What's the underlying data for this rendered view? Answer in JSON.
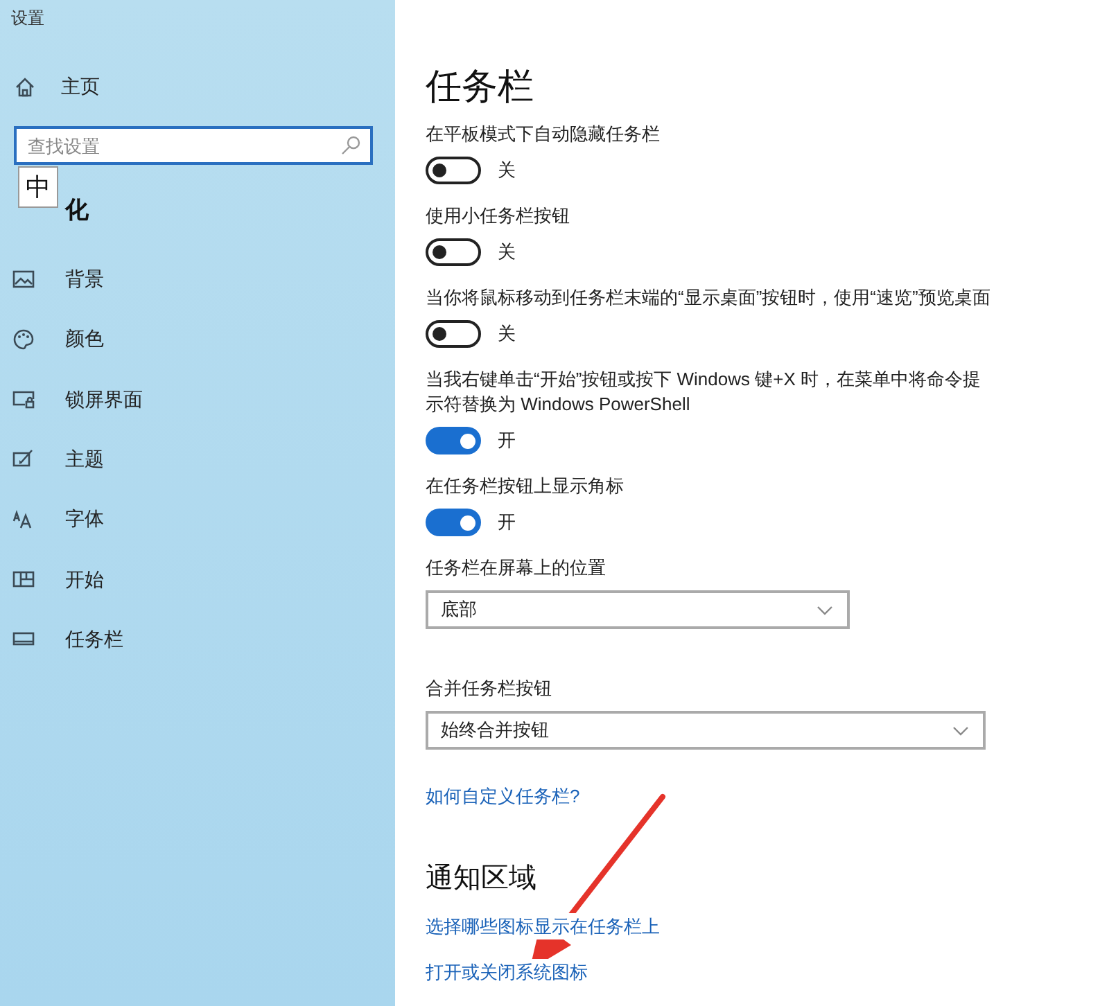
{
  "window": {
    "title": "设置"
  },
  "sidebar": {
    "home": "主页",
    "search": {
      "placeholder": "查找设置"
    },
    "ime_indicator": "中",
    "section": "化",
    "items": [
      {
        "label": "背景"
      },
      {
        "label": "颜色"
      },
      {
        "label": "锁屏界面"
      },
      {
        "label": "主题"
      },
      {
        "label": "字体"
      },
      {
        "label": "开始"
      },
      {
        "label": "任务栏"
      }
    ]
  },
  "main": {
    "title": "任务栏",
    "settings": [
      {
        "kind": "toggle",
        "label": "在平板模式下自动隐藏任务栏",
        "on": false,
        "state_text": "关"
      },
      {
        "kind": "toggle",
        "label": "使用小任务栏按钮",
        "on": false,
        "state_text": "关"
      },
      {
        "kind": "toggle",
        "label": "当你将鼠标移动到任务栏末端的“显示桌面”按钮时，使用“速览”预览桌面",
        "on": false,
        "state_text": "关"
      },
      {
        "kind": "toggle",
        "label": "当我右键单击“开始”按钮或按下 Windows 键+X 时，在菜单中将命令提示符替换为 Windows PowerShell",
        "on": true,
        "state_text": "开"
      },
      {
        "kind": "toggle",
        "label": "在任务栏按钮上显示角标",
        "on": true,
        "state_text": "开"
      },
      {
        "kind": "dropdown",
        "label": "任务栏在屏幕上的位置",
        "value": "底部"
      },
      {
        "kind": "dropdown",
        "label": "合并任务栏按钮",
        "value": "始终合并按钮"
      }
    ],
    "help_link": "如何自定义任务栏?",
    "notification_area": {
      "heading": "通知区域",
      "links": [
        "选择哪些图标显示在任务栏上",
        "打开或关闭系统图标"
      ]
    }
  }
}
